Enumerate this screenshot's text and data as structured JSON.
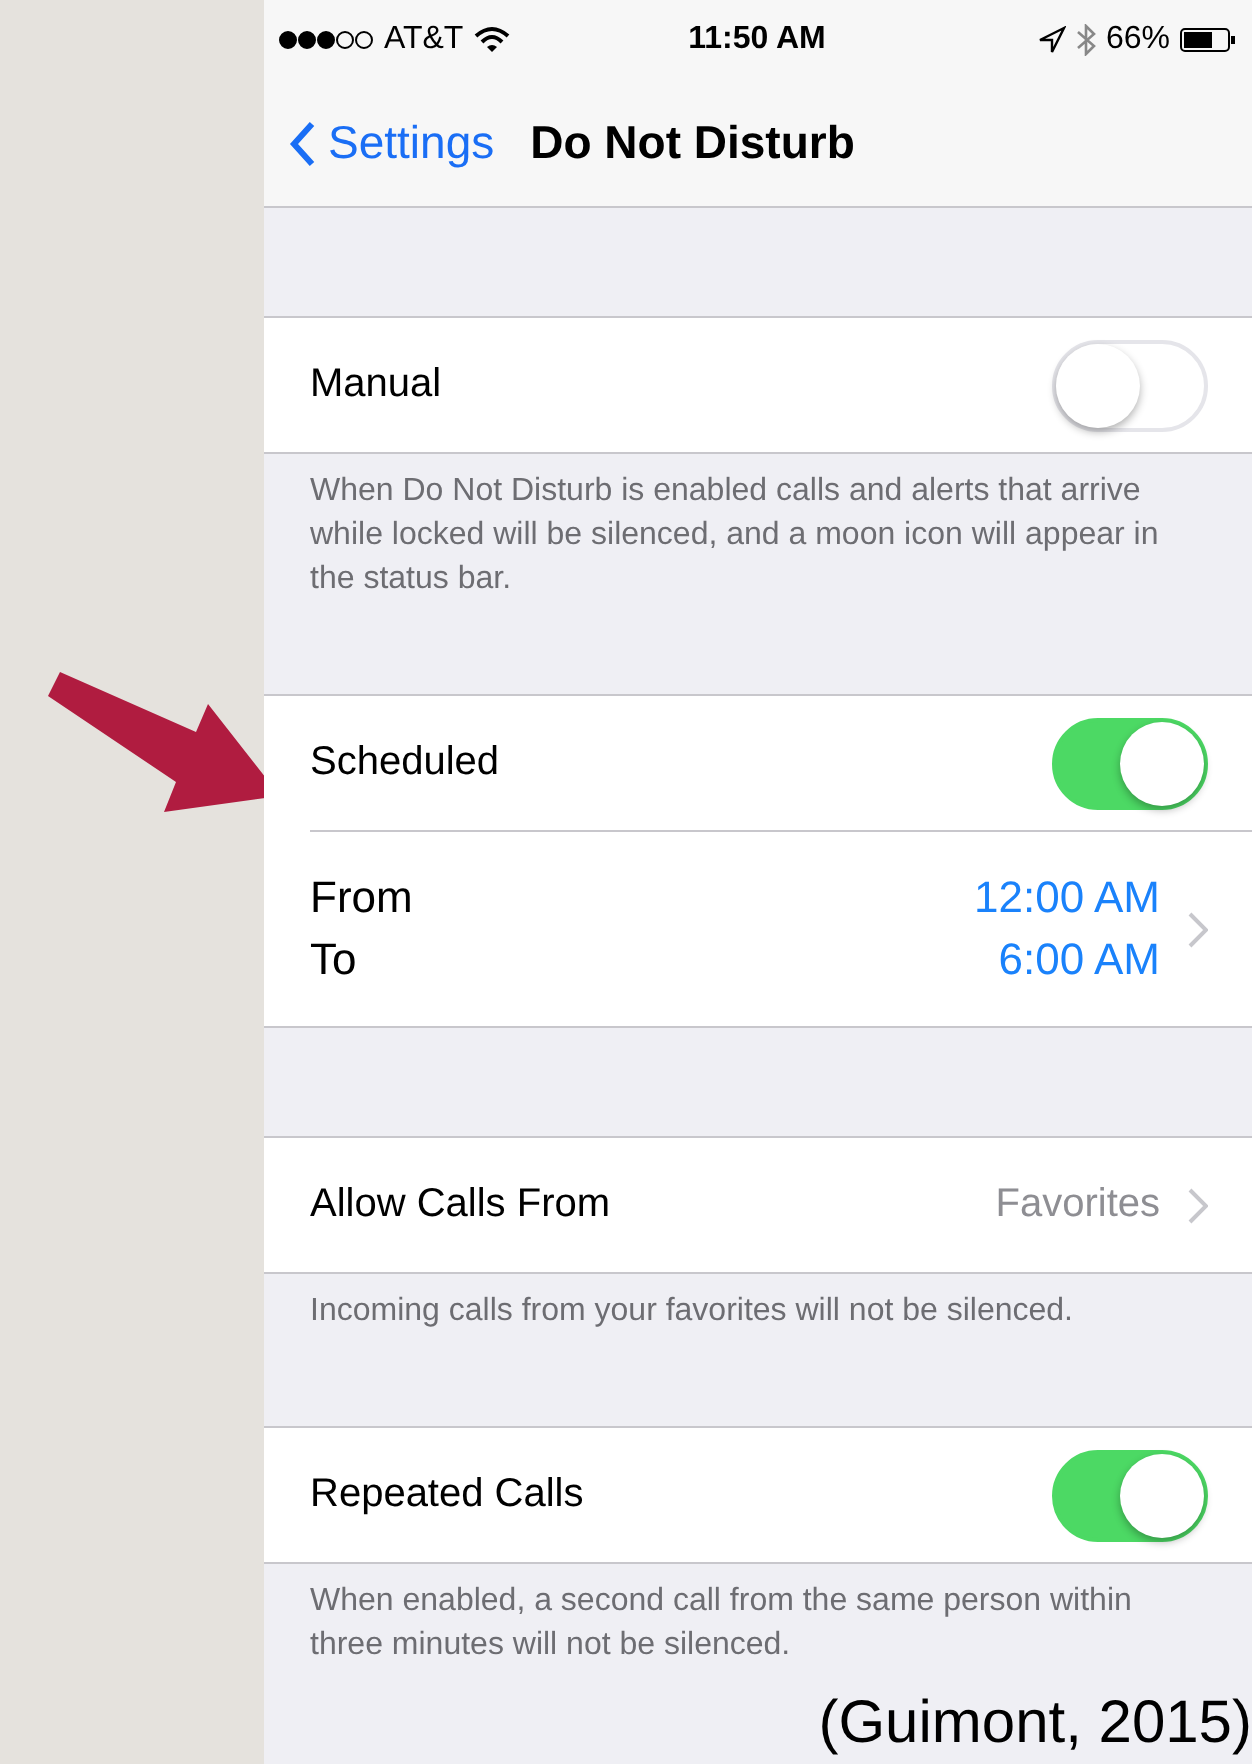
{
  "status_bar": {
    "carrier": "AT&T",
    "time": "11:50 AM",
    "battery": "66%"
  },
  "nav": {
    "back": "Settings",
    "title": "Do Not Disturb"
  },
  "sections": [
    {
      "rows": [
        {
          "kind": "toggle",
          "label": "Manual",
          "on": false
        }
      ],
      "footer": "When Do Not Disturb is enabled calls and alerts that arrive while locked will be silenced, and a moon icon will appear in the status bar."
    },
    {
      "rows": [
        {
          "kind": "toggle",
          "label": "Scheduled",
          "on": true
        },
        {
          "kind": "schedule",
          "from_label": "From",
          "from_value": "12:00 AM",
          "to_label": "To",
          "to_value": "6:00 AM"
        }
      ]
    },
    {
      "rows": [
        {
          "kind": "detail",
          "label": "Allow Calls From",
          "value": "Favorites"
        }
      ],
      "footer": "Incoming calls from your favorites will not be silenced."
    },
    {
      "rows": [
        {
          "kind": "toggle",
          "label": "Repeated Calls",
          "on": true
        }
      ],
      "footer": "When enabled, a second call from the same person within three minutes will not be silenced."
    }
  ],
  "citation": "(Guimont, 2015)"
}
